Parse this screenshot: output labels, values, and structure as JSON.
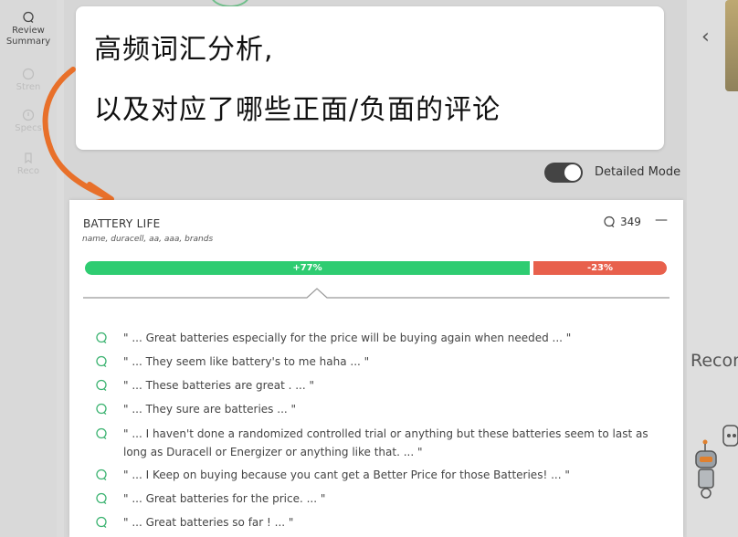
{
  "rail": {
    "items": [
      {
        "label": "Review Summary",
        "line1": "Review",
        "line2": "Summary",
        "icon": "chat-bubble-icon"
      },
      {
        "label": "Stren",
        "icon": "thumb-icon"
      },
      {
        "label": "Specs",
        "icon": "info-icon"
      },
      {
        "label": "Reco",
        "icon": "bookmark-icon"
      }
    ]
  },
  "note": {
    "line1": "高频词汇分析,",
    "line2": "以及对应了哪些正面/负面的评论"
  },
  "toggle": {
    "label": "Detailed Mode",
    "on": true
  },
  "right": {
    "reco_title": "Recon"
  },
  "card": {
    "title": "BATTERY LIFE",
    "subtitle": "name, duracell, aa, aaa, brands",
    "count": "349",
    "collapse_symbol": "—",
    "positive_label": "+77%",
    "positive_fraction": 0.77,
    "negative_label": "-23%",
    "negative_fraction": 0.23,
    "colors": {
      "positive": "#2ecc71",
      "negative": "#e8604c",
      "quote_icon": "#3cb371"
    },
    "quotes": [
      "\" ...  Great batteries especially for the price will be buying again when needed  ...  \"",
      "\" ...  They seem like battery's to me haha  ...  \"",
      "\" ...  These batteries are great .  ...  \"",
      "\" ...  They sure are batteries  ...  \"",
      "\" ...  I haven't done a randomized controlled trial or anything but these batteries seem to last as long as Duracell or Energizer or anything like that.  ...  \"",
      "\" ...  I Keep on buying because you cant get a Better Price for those Batteries!  ...  \"",
      "\" ...  Great batteries for the price.  ...  \"",
      "\" ...  Great batteries so far !  ...  \""
    ]
  }
}
